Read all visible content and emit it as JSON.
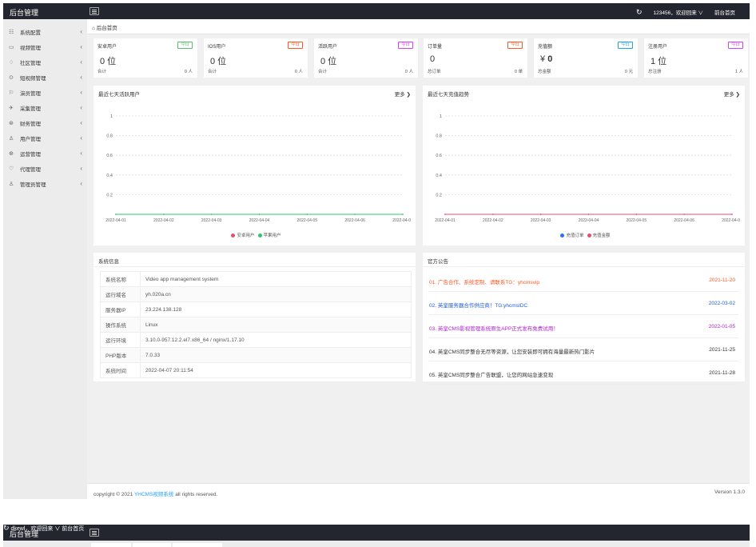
{
  "app": {
    "title": "后台管理",
    "user_menu": "123456，欢迎回来 ∨",
    "front_link": "前台首页"
  },
  "sidebar": {
    "items": [
      {
        "label": "系统配置",
        "icon": "system-icon",
        "glyph": "☷"
      },
      {
        "label": "视频管理",
        "icon": "video-icon",
        "glyph": "▭"
      },
      {
        "label": "社区管理",
        "icon": "community-icon",
        "glyph": "♢"
      },
      {
        "label": "短视频管理",
        "icon": "short-video-icon",
        "glyph": "⊙"
      },
      {
        "label": "演员管理",
        "icon": "actor-icon",
        "glyph": "⚐"
      },
      {
        "label": "采集管理",
        "icon": "collect-icon",
        "glyph": "✈"
      },
      {
        "label": "财务管理",
        "icon": "finance-icon",
        "glyph": "⊛"
      },
      {
        "label": "用户管理",
        "icon": "user-icon",
        "glyph": "♙"
      },
      {
        "label": "运营管理",
        "icon": "operation-icon",
        "glyph": "⊕"
      },
      {
        "label": "代理管理",
        "icon": "agent-icon",
        "glyph": "♡"
      },
      {
        "label": "管理员管理",
        "icon": "admin-icon",
        "glyph": "♙"
      }
    ]
  },
  "tab": {
    "home": "后台首页"
  },
  "stats": [
    {
      "title": "安卓用户",
      "badge": "今日",
      "badge_color": "#5fb878",
      "value": "0 位",
      "foot_left": "合计",
      "foot_right": "0 人"
    },
    {
      "title": "IOS用户",
      "badge": "今日",
      "badge_color": "#ff5722",
      "value": "0 位",
      "foot_left": "合计",
      "foot_right": "0 人"
    },
    {
      "title": "活跃用户",
      "badge": "今日",
      "badge_color": "#d642f2",
      "value": "0 位",
      "foot_left": "合计",
      "foot_right": "0 人"
    },
    {
      "title": "订单量",
      "badge": "今日",
      "badge_color": "#ff5722",
      "value": "0",
      "foot_left": "总订单",
      "foot_right": "0 单"
    },
    {
      "title": "充值额",
      "badge": "今日",
      "badge_color": "#1e9fff",
      "value_prefix": "¥ ",
      "value_bold": "0",
      "foot_left": "总金额",
      "foot_right": "0 元"
    },
    {
      "title": "注册用户",
      "badge": "今日",
      "badge_color": "#d642f2",
      "value": "1 位",
      "foot_left": "总注册",
      "foot_right": "1 人"
    }
  ],
  "panels": {
    "active_title": "最近七天活跃用户",
    "recharge_title": "最近七天充值趋势",
    "more": "更多",
    "sysinfo_title": "系统信息",
    "notice_title": "官方公告"
  },
  "chart_data": [
    {
      "type": "line",
      "title": "最近七天活跃用户",
      "categories": [
        "2022-04-01",
        "2022-04-02",
        "2022-04-03",
        "2022-04-04",
        "2022-04-05",
        "2022-04-06",
        "2022-04-07"
      ],
      "series": [
        {
          "name": "安卓用户",
          "color": "#ea4c6e",
          "values": [
            0,
            0,
            0,
            0,
            0,
            0,
            0
          ]
        },
        {
          "name": "苹果用户",
          "color": "#2ec770",
          "values": [
            0,
            0,
            0,
            0,
            0,
            0,
            0
          ]
        }
      ],
      "yticks": [
        1,
        0.8,
        0.6,
        0.4,
        0.2
      ],
      "ylim": [
        0,
        1
      ],
      "grid": true,
      "legend": "bottom"
    },
    {
      "type": "line",
      "title": "最近七天充值趋势",
      "categories": [
        "2022-04-01",
        "2022-04-02",
        "2022-04-03",
        "2022-04-04",
        "2022-04-05",
        "2022-04-06",
        "2022-04-07"
      ],
      "series": [
        {
          "name": "充值订单",
          "color": "#2f6bff",
          "values": [
            0,
            0,
            0,
            0,
            0,
            0,
            0
          ]
        },
        {
          "name": "充值金额",
          "color": "#ea4c6e",
          "values": [
            0,
            0,
            0,
            0,
            0,
            0,
            0
          ]
        }
      ],
      "yticks": [
        1,
        0.8,
        0.6,
        0.4,
        0.2
      ],
      "ylim": [
        0,
        1
      ],
      "grid": true,
      "legend": "bottom"
    }
  ],
  "sysinfo": [
    {
      "k": "系统名称",
      "v": "Video app management system"
    },
    {
      "k": "运行域名",
      "v": "yh.020a.cn"
    },
    {
      "k": "服务器IP",
      "v": "23.224.138.128"
    },
    {
      "k": "操作系统",
      "v": "Linux"
    },
    {
      "k": "运行环境",
      "v": "3.10.0-957.12.2.el7.x86_64 / nginx/1.17.10"
    },
    {
      "k": "PHP版本",
      "v": "7.0.33"
    },
    {
      "k": "系统时间",
      "v": "2022-04-07 20:11:54"
    }
  ],
  "notices": [
    {
      "text": "01. 广告合作、系统定制、请联系TG：yhcmsvip",
      "date": "2021-11-20",
      "color": "#ff5722"
    },
    {
      "text": "02. 英皇服务器合作供应商！TG:yhcmsIDC",
      "date": "2022-03-02",
      "color": "#1e5bd8"
    },
    {
      "text": "03. 英皇CMS影视管理系统原生APP正式发布免费试用！",
      "date": "2022-01-05",
      "color": "#b01ecf"
    },
    {
      "text": "04. 英皇CMS同步整合无尽等资源，让您安装即可拥有海量最新热门影片",
      "date": "2021-11-25",
      "color": "#333333"
    },
    {
      "text": "05. 英皇CMS同步整合广告联盟，让您的网站急速变现",
      "date": "2021-11-28",
      "color": "#333333"
    }
  ],
  "footer": {
    "prefix": "copyright © 2021 ",
    "link": "YHCMS视频系统",
    "suffix": " all rights reserved.",
    "version": "Version 1.3.0"
  },
  "window2": {
    "title": "后台管理",
    "user_menu": "dkewl，欢迎回来 ∨",
    "front_link": "前台首页"
  }
}
